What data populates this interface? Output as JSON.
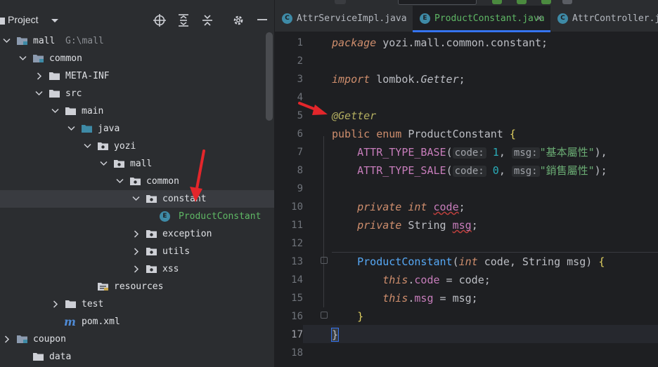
{
  "project_panel": {
    "title": "Project",
    "tools": [
      "locate-icon",
      "expand-all-icon",
      "collapse-all-icon",
      "gear-icon",
      "minimize-icon"
    ]
  },
  "tree": [
    {
      "label": "mall",
      "hint": "G:\\mall",
      "expanded": true,
      "kind": "module"
    },
    {
      "label": "common",
      "expanded": true,
      "kind": "module"
    },
    {
      "label": "META-INF",
      "expanded": false,
      "kind": "folder"
    },
    {
      "label": "src",
      "expanded": true,
      "kind": "folder"
    },
    {
      "label": "main",
      "expanded": true,
      "kind": "folder"
    },
    {
      "label": "java",
      "expanded": true,
      "kind": "source-folder"
    },
    {
      "label": "yozi",
      "expanded": true,
      "kind": "package"
    },
    {
      "label": "mall",
      "expanded": true,
      "kind": "package"
    },
    {
      "label": "common",
      "expanded": true,
      "kind": "package"
    },
    {
      "label": "constant",
      "expanded": true,
      "kind": "package",
      "selected": true
    },
    {
      "label": "ProductConstant",
      "kind": "enum-file"
    },
    {
      "label": "exception",
      "expanded": false,
      "kind": "package"
    },
    {
      "label": "utils",
      "expanded": false,
      "kind": "package"
    },
    {
      "label": "xss",
      "expanded": false,
      "kind": "package"
    },
    {
      "label": "resources",
      "kind": "resources-folder"
    },
    {
      "label": "test",
      "expanded": false,
      "kind": "folder"
    },
    {
      "label": "pom.xml",
      "kind": "maven-file"
    },
    {
      "label": "coupon",
      "expanded": false,
      "kind": "module"
    },
    {
      "label": "data",
      "kind": "folder"
    }
  ],
  "tabs": [
    {
      "label": "AttrServiceImpl.java",
      "icon": "C",
      "active": false
    },
    {
      "label": "ProductConstant.java",
      "icon": "E",
      "active": true,
      "close": "×"
    },
    {
      "label": "AttrController.jav",
      "icon": "C",
      "active": false
    }
  ],
  "gutter": [
    "1",
    "2",
    "3",
    "4",
    "5",
    "6",
    "7",
    "8",
    "9",
    "10",
    "11",
    "12",
    "13",
    "14",
    "15",
    "16",
    "17",
    "18"
  ],
  "code": {
    "l1": {
      "kw": "package",
      "rest": " yozi.mall.common.constant;"
    },
    "l3": {
      "kw": "import",
      "pkg": " lombok.",
      "cls": "Getter",
      "semi": ";"
    },
    "l5": {
      "ann": "@Getter"
    },
    "l6": {
      "kw1": "public",
      "kw2": "enum",
      "name": " ProductConstant ",
      "brace": "{"
    },
    "l7": {
      "const": "ATTR_TYPE_BASE",
      "open": "(",
      "hint1": "code:",
      "num": " 1",
      "comma": ", ",
      "hint2": "msg:",
      "str": "\"基本屬性\"",
      "close": "),"
    },
    "l8": {
      "const": "ATTR_TYPE_SALE",
      "open": "(",
      "hint1": "code:",
      "num": " 0",
      "comma": ", ",
      "hint2": "msg:",
      "str": "\"銷售屬性\"",
      "close": ");"
    },
    "l10": {
      "kw1": "private",
      "kw2": "int",
      "field": "code",
      "semi": ";"
    },
    "l11": {
      "kw1": "private",
      "type": " String ",
      "field": "msg",
      "semi": ";"
    },
    "l13": {
      "name": "ProductConstant",
      "open": "(",
      "kw": "int",
      "p1": " code, String msg) ",
      "brace": "{"
    },
    "l14": {
      "kw": "this",
      "dot": ".",
      "field": "code",
      "rest": " = code;"
    },
    "l15": {
      "kw": "this",
      "dot": ".",
      "field": "msg",
      "rest": " = msg;"
    },
    "l16": {
      "brace": "}"
    },
    "l17": {
      "brace": "}"
    }
  },
  "colors": {
    "accent": "#3574f0",
    "arrow": "#e3262b",
    "selected_row": "#393b40"
  }
}
